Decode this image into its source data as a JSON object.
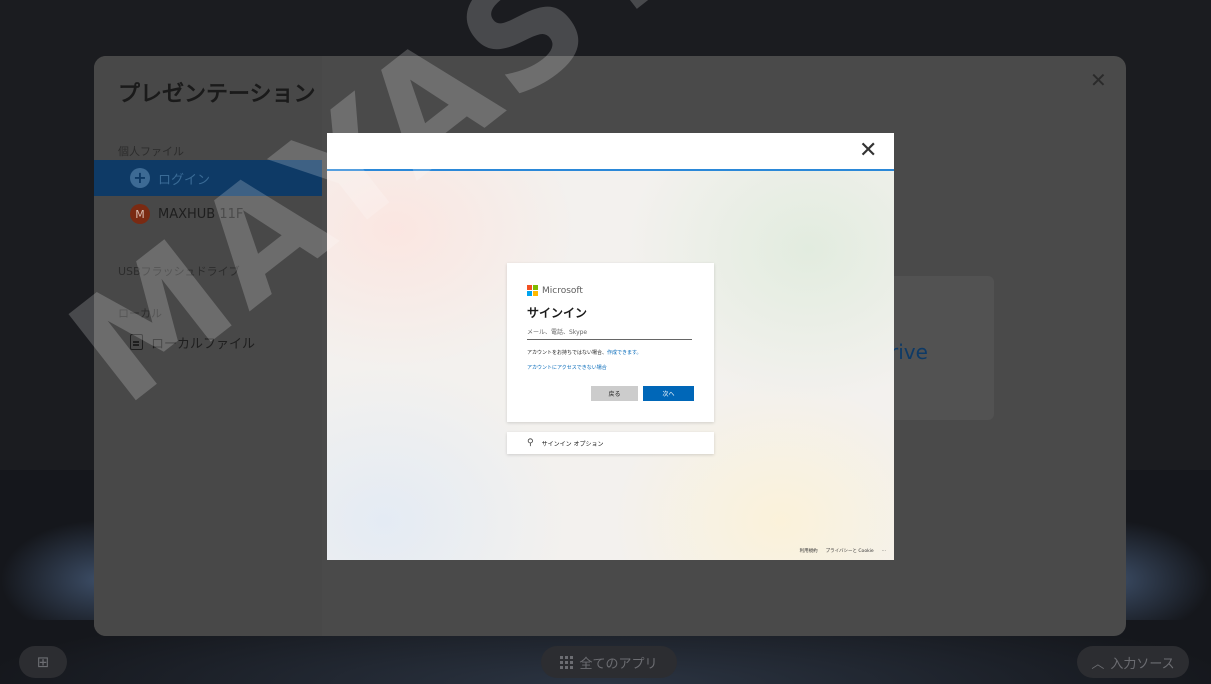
{
  "panel": {
    "title": "プレゼンテーション",
    "sections": {
      "personal_files": "個人ファイル",
      "usb": "USBフラッシュドライブ",
      "local": "ローカル"
    },
    "items": {
      "login": "ログイン",
      "account": "MAXHUB 11F",
      "account_initial": "M",
      "local_files": "ローカルファイル"
    },
    "onedrive_partial": "rive"
  },
  "dialog": {
    "brand": "Microsoft",
    "title": "サインイン",
    "input_placeholder": "メール、電話、Skype",
    "no_account_text": "アカウントをお持ちではない場合、",
    "create_link": "作成できます。",
    "cant_access_link": "アカウントにアクセスできない場合",
    "back_button": "戻る",
    "next_button": "次へ",
    "signin_options": "サインイン オプション",
    "footer": {
      "terms": "利用規約",
      "privacy": "プライバシーと Cookie",
      "more": "..."
    }
  },
  "taskbar": {
    "left_icon": "grid-icon",
    "all_apps": "全てのアプリ",
    "input_source": "入力ソース"
  },
  "watermark": "MAYASYS",
  "colors": {
    "accent": "#0067b8",
    "panel_active": "#0e3a66",
    "ms_red": "#f25022",
    "ms_green": "#7fba00",
    "ms_blue": "#00a4ef",
    "ms_yellow": "#ffb900"
  }
}
